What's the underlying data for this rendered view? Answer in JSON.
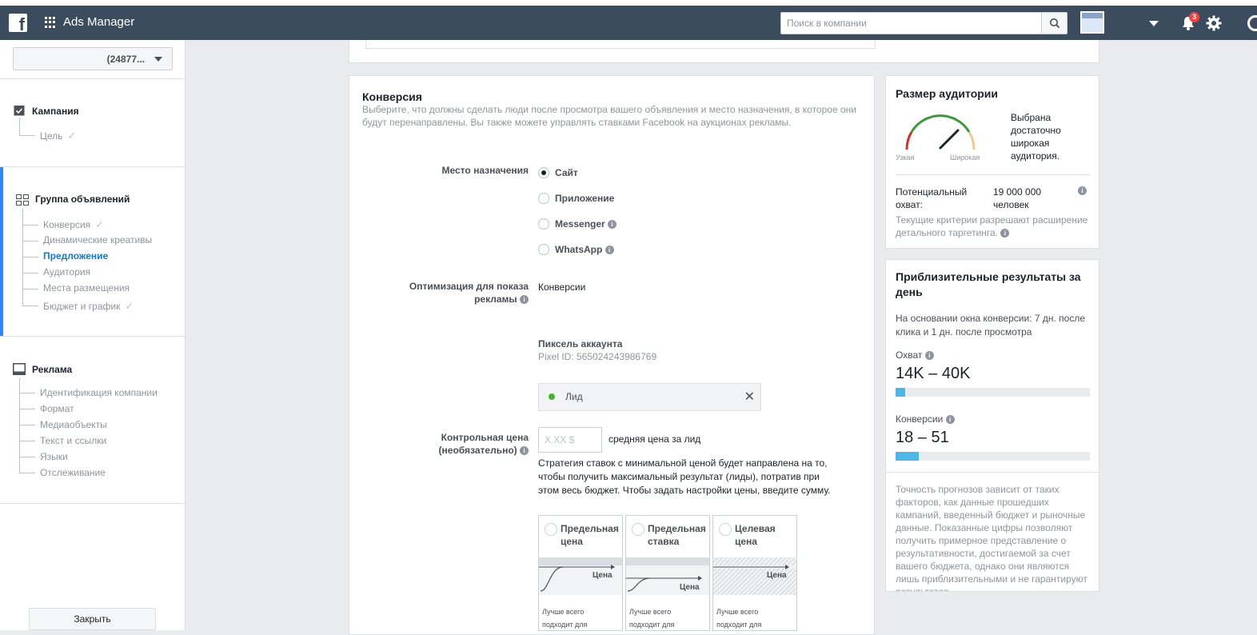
{
  "topbar": {
    "app_name": "Ads Manager",
    "search_placeholder": "Поиск в компании",
    "notifications_count": "3"
  },
  "sidebar": {
    "account_label": "(24877...",
    "campaign": {
      "title": "Кампания",
      "items": [
        {
          "label": "Цель",
          "checked": true
        }
      ]
    },
    "adset": {
      "title": "Группа объявлений",
      "items": [
        {
          "label": "Конверсия",
          "checked": true
        },
        {
          "label": "Динамические креативы",
          "checked": false
        },
        {
          "label": "Предложение",
          "checked": false,
          "active": true
        },
        {
          "label": "Аудитория",
          "checked": false
        },
        {
          "label": "Места размещения",
          "checked": false
        },
        {
          "label": "Бюджет и график",
          "checked": true
        }
      ]
    },
    "ad": {
      "title": "Реклама",
      "items": [
        {
          "label": "Идентификация компании"
        },
        {
          "label": "Формат"
        },
        {
          "label": "Медиаобъекты"
        },
        {
          "label": "Текст и ссылки"
        },
        {
          "label": "Языки"
        },
        {
          "label": "Отслеживание"
        }
      ]
    },
    "close_label": "Закрыть"
  },
  "conversion": {
    "title": "Конверсия",
    "description": "Выберите, что должны сделать люди после просмотра вашего объявления и место назначения, в которое они будут перенаправлены. Вы также можете управлять ставками Facebook на аукционах рекламы.",
    "destination_label": "Место назначения",
    "destinations": [
      {
        "label": "Сайт",
        "selected": true,
        "info": false
      },
      {
        "label": "Приложение",
        "selected": false,
        "info": false
      },
      {
        "label": "Messenger",
        "selected": false,
        "info": true
      },
      {
        "label": "WhatsApp",
        "selected": false,
        "info": true
      }
    ],
    "optimization_label_1": "Оптимизация для показа",
    "optimization_label_2": "рекламы",
    "optimization_value": "Конверсии",
    "pixel_title": "Пиксель аккаунта",
    "pixel_id": "Pixel ID: 565024243986769",
    "event": "Лид",
    "control_price_label_1": "Контрольная цена",
    "control_price_label_2": "(необязательно)",
    "price_placeholder": "X.XX $",
    "price_suffix": "средняя цена за лид",
    "strategy_text": "Стратегия ставок с минимальной ценой будет направлена на то, чтобы получить максимальный результат (лиды), потратив при этом весь бюджет. Чтобы задать настройки цены, введите сумму.",
    "bid_options": [
      {
        "title": "Предельная цена",
        "graph_label": "Цена",
        "desc": "Лучше всего подходит для"
      },
      {
        "title": "Предельная ставка",
        "graph_label": "Цена",
        "desc": "Лучше всего подходит для"
      },
      {
        "title": "Целевая цена",
        "graph_label": "Цена",
        "desc": "Лучше всего подходит для"
      }
    ]
  },
  "audience": {
    "title": "Размер аудитории",
    "gauge_narrow": "Узкая",
    "gauge_wide": "Широкая",
    "gauge_text": "Выбрана достаточно широкая аудитория.",
    "reach_label": "Потенциальный охват:",
    "reach_value": "19 000 000 человек",
    "criteria": "Текущие критерии разрешают расширение детального таргетинга."
  },
  "results": {
    "title": "Приблизительные результаты за день",
    "basis": "На основании окна конверсии: 7 дн. после клика и 1 дн. после просмотра",
    "reach_label": "Охват",
    "reach_value": "14K – 40K",
    "reach_fill": 0.05,
    "conv_label": "Конверсии",
    "conv_value": "18 – 51",
    "conv_fill": 0.12,
    "disclaimer": "Точность прогнозов зависит от таких факторов, как данные прошедших кампаний, введенный бюджет и рыночные данные. Показанные цифры позволяют получить примерное представление о результативности, достигаемой за счет вашего бюджета, однако они являются лишь приблизительными и не гарантируют результатов"
  },
  "colors": {
    "topbar": "#3b4c5e",
    "accent": "#1877d2",
    "bar": "#4cb8ea"
  }
}
